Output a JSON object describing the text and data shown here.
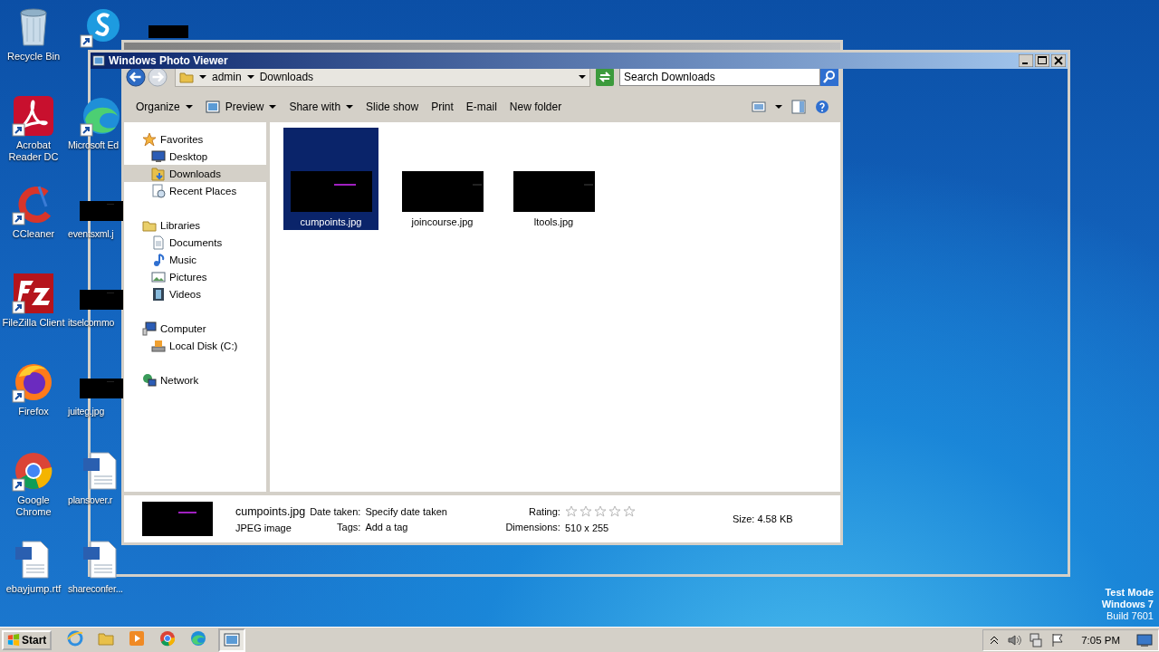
{
  "desktop": {
    "columns": [
      [
        {
          "label": "Recycle Bin",
          "kind": "trash"
        },
        {
          "label": "Acrobat Reader DC",
          "kind": "pdf",
          "shortcut": true
        },
        {
          "label": "CCleaner",
          "kind": "cleaner",
          "shortcut": true
        },
        {
          "label": "FileZilla Client",
          "kind": "ftp",
          "shortcut": true
        },
        {
          "label": "Firefox",
          "kind": "firefox",
          "shortcut": true
        },
        {
          "label": "Google Chrome",
          "kind": "chrome",
          "shortcut": true
        },
        {
          "label": "ebayjump.rtf",
          "kind": "word"
        }
      ],
      [
        {
          "kind": "chat",
          "shortcut": true,
          "redacted": true
        },
        {
          "label": "Microsoft Ed",
          "kind": "edge",
          "shortcut": true
        },
        {
          "label": "eventsxml.j"
        },
        {
          "label": "itselcommo"
        },
        {
          "label": "juiteg.jpg"
        },
        {
          "label": "plansover.r",
          "kind": "word"
        },
        {
          "label": "shareconfer...",
          "kind": "word"
        }
      ]
    ],
    "notice": [
      "Test Mode",
      "Windows 7",
      "Build 7601"
    ]
  },
  "photo_viewer": {
    "title": "Windows Photo Viewer"
  },
  "explorer": {
    "address": {
      "crumbs": [
        "admin",
        "Downloads"
      ]
    },
    "search": {
      "placeholder": "Search Downloads"
    },
    "toolbar": [
      {
        "label": "Organize",
        "menu": true
      },
      {
        "label": "Preview",
        "menu": true,
        "icon": true
      },
      {
        "label": "Share with",
        "menu": true
      },
      {
        "label": "Slide show",
        "menu": false
      },
      {
        "label": "Print",
        "menu": false
      },
      {
        "label": "E-mail",
        "menu": false
      },
      {
        "label": "New folder",
        "menu": false
      }
    ],
    "sidebar": [
      {
        "label": "Favorites",
        "kind": "star",
        "selected": false,
        "children": [
          {
            "label": "Desktop",
            "kind": "desktop",
            "selected": false
          },
          {
            "label": "Downloads",
            "kind": "downloads",
            "selected": true
          },
          {
            "label": "Recent Places",
            "kind": "recent",
            "selected": false
          }
        ]
      },
      {
        "label": "Libraries",
        "kind": "library",
        "selected": false,
        "children": [
          {
            "label": "Documents",
            "kind": "documents",
            "selected": false
          },
          {
            "label": "Music",
            "kind": "music",
            "selected": false
          },
          {
            "label": "Pictures",
            "kind": "pictures",
            "selected": false
          },
          {
            "label": "Videos",
            "kind": "videos",
            "selected": false
          }
        ]
      },
      {
        "label": "Computer",
        "kind": "computer",
        "selected": false,
        "children": [
          {
            "label": "Local Disk (C:)",
            "kind": "disk",
            "selected": false
          }
        ]
      },
      {
        "label": "Network",
        "kind": "network",
        "selected": false
      }
    ],
    "files": [
      {
        "name": "cumpoints.jpg",
        "selected": true
      },
      {
        "name": "joincourse.jpg",
        "selected": false
      },
      {
        "name": "ltools.jpg",
        "selected": false
      }
    ],
    "details": {
      "name": "cumpoints.jpg",
      "type": "JPEG image",
      "date_label": "Date taken:",
      "date_value": "Specify date taken",
      "tags_label": "Tags:",
      "tags_value": "Add a tag",
      "rating_label": "Rating:",
      "stars": 0,
      "dimensions_label": "Dimensions:",
      "dimensions_value": "510 x 255",
      "size_label": "Size:",
      "size_value": "4.58 KB"
    }
  },
  "taskbar": {
    "start": "Start",
    "apps": [
      {
        "kind": "ie",
        "selected": false
      },
      {
        "kind": "explorer",
        "selected": false
      },
      {
        "kind": "media",
        "selected": false
      },
      {
        "kind": "chrome",
        "selected": false
      },
      {
        "kind": "edge",
        "selected": false
      },
      {
        "kind": "photos",
        "selected": true
      }
    ],
    "time": "7:05 PM"
  }
}
